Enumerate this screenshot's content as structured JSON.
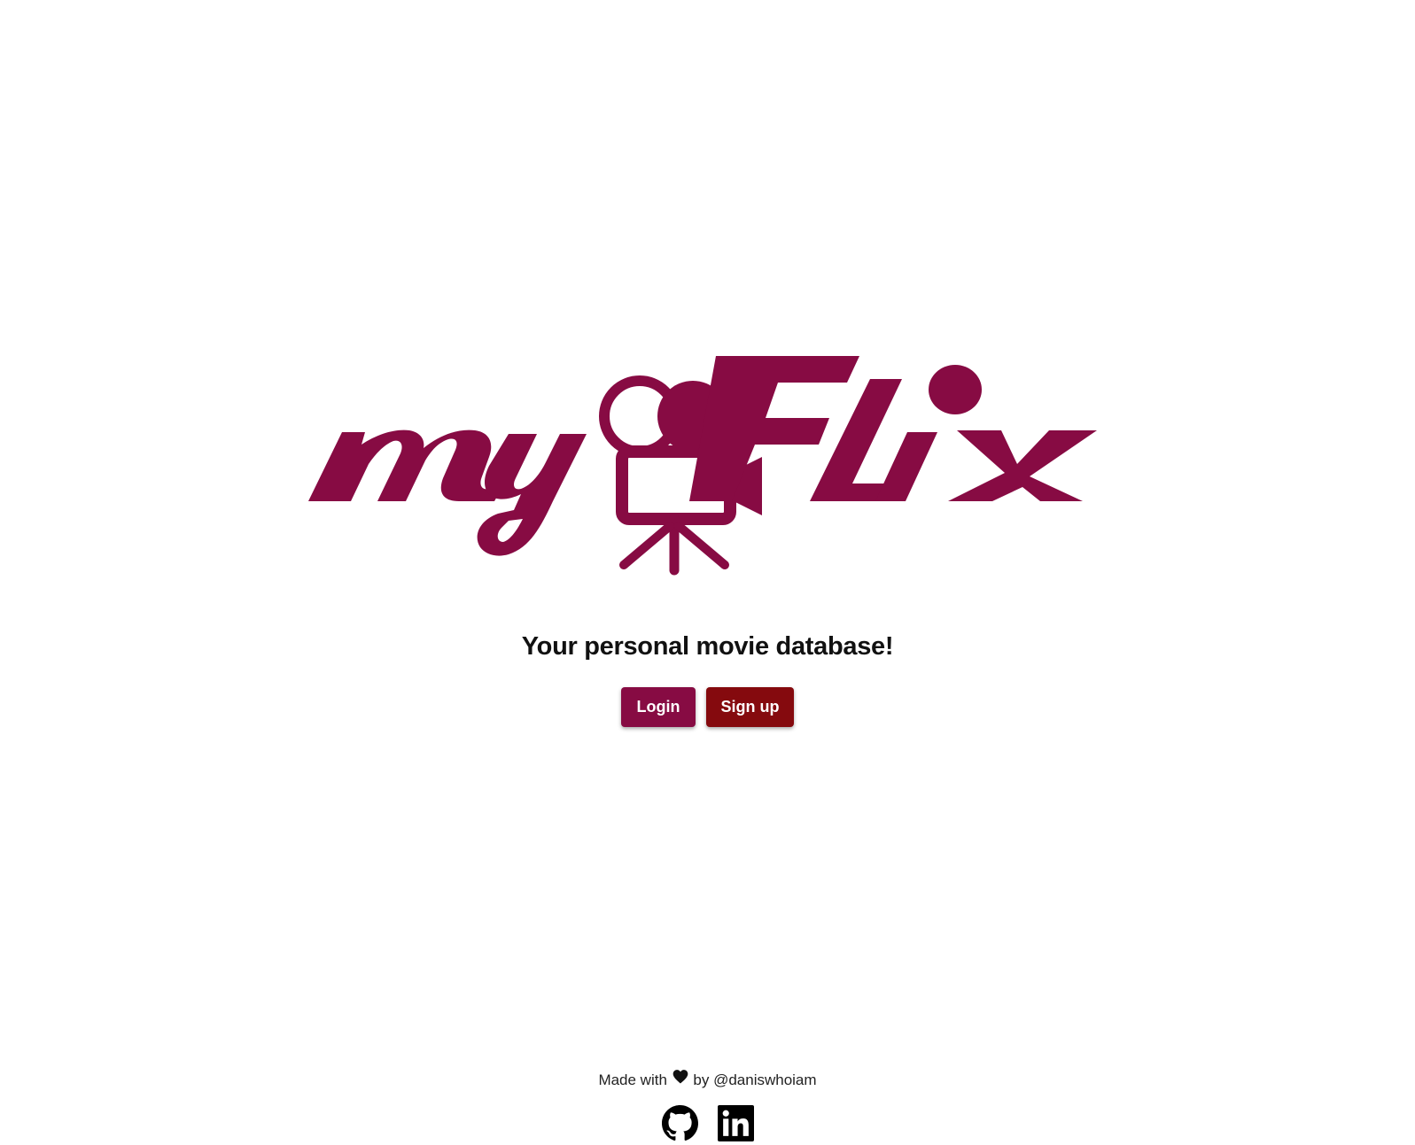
{
  "brand": {
    "logo_text": "myFlix",
    "color": "#870b43"
  },
  "hero": {
    "tagline": "Your personal movie database!"
  },
  "actions": {
    "login_label": "Login",
    "login_color": "#870b43",
    "signup_label": "Sign up",
    "signup_color": "#850a0e"
  },
  "footer": {
    "made_with": "Made with",
    "by_text": "by @daniswhoiam",
    "heart_icon": "heart-icon",
    "links": [
      {
        "icon": "github-icon"
      },
      {
        "icon": "linkedin-icon"
      }
    ]
  }
}
